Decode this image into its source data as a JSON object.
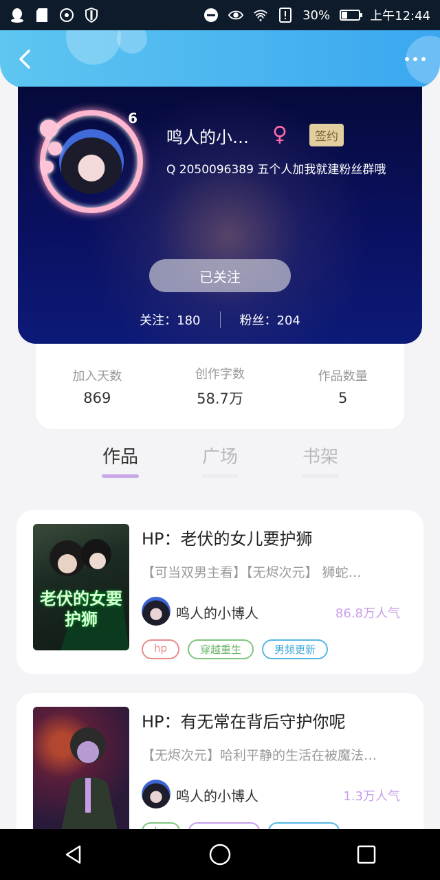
{
  "status_bar": {
    "battery_percent": "30%",
    "time": "上午12:44",
    "icons": [
      "qq-icon",
      "sd-card-icon",
      "hotspot-icon",
      "shield-icon",
      "dnd-icon",
      "eye-icon",
      "wifi-icon",
      "alert-icon",
      "battery-icon"
    ]
  },
  "appbar": {
    "back_icon": "chevron-left-icon",
    "more_icon": "more-dots-icon"
  },
  "profile": {
    "level": "6",
    "name": "鸣人的小…",
    "gender_symbol": "♀",
    "sign_badge": "签约",
    "description": "Q 2050096389 五个人加我就建粉丝群哦",
    "follow_button": "已关注",
    "following_label": "关注：",
    "following_count": "180",
    "fans_label": "粉丝：",
    "fans_count": "204"
  },
  "stats": [
    {
      "label": "加入天数",
      "value": "869"
    },
    {
      "label": "创作字数",
      "value": "58.7万"
    },
    {
      "label": "作品数量",
      "value": "5"
    }
  ],
  "tabs": [
    {
      "label": "作品",
      "active": true
    },
    {
      "label": "广场",
      "active": false
    },
    {
      "label": "书架",
      "active": false
    }
  ],
  "books": [
    {
      "title": "HP：老伏的女儿要护狮",
      "description": "【可当双男主看】【无烬次元】 狮蛇…",
      "cover_text": "老伏的女要护狮",
      "author": "鸣人的小博人",
      "popularity": "86.8万人气",
      "tags": [
        {
          "label": "hp",
          "color": "#e88b8b"
        },
        {
          "label": "穿越重生",
          "color": "#7fc47f"
        },
        {
          "label": "男频更新",
          "color": "#55b6e3"
        }
      ]
    },
    {
      "title": "HP：有无常在背后守护你呢",
      "description": "【无烬次元】哈利平静的生活在被魔法…",
      "cover_text": "",
      "author": "鸣人的小博人",
      "popularity": "1.3万人气",
      "tags": [
        {
          "label": "hp",
          "color": "#7fc47f"
        },
        {
          "label": "",
          "color": "#c89ee8"
        },
        {
          "label": "",
          "color": "#55b6e3"
        }
      ]
    }
  ],
  "bottom_nav": [
    "back-triangle-icon",
    "home-circle-icon",
    "recents-square-icon"
  ]
}
